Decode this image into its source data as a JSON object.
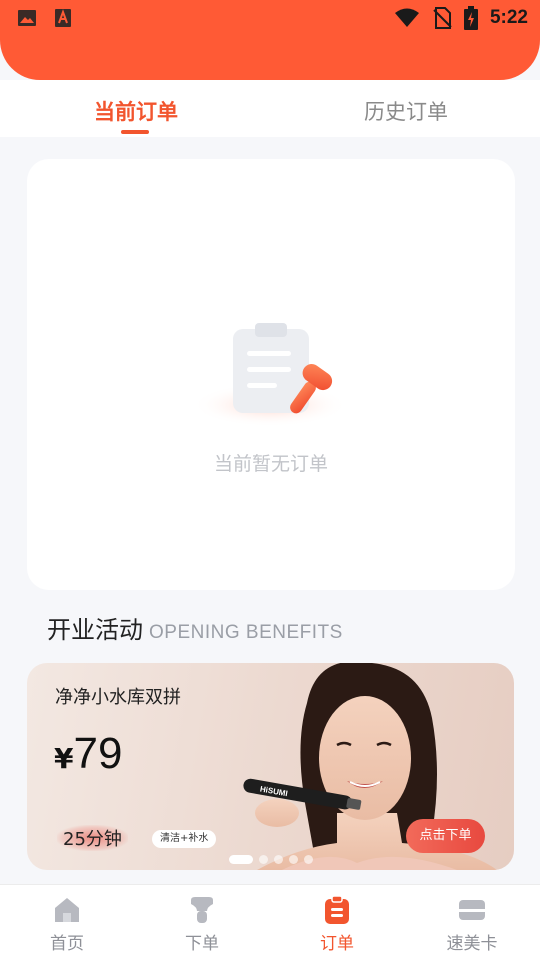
{
  "status_bar": {
    "time": "5:22",
    "left_icons": [
      "image-icon",
      "font-app-icon"
    ],
    "right_icons": [
      "wifi-icon",
      "no-sim-icon",
      "battery-charging-icon"
    ],
    "background_color": "#ff5a35"
  },
  "tabs": [
    {
      "label": "当前订单",
      "active": true
    },
    {
      "label": "历史订单",
      "active": false
    }
  ],
  "empty_state": {
    "illustration": "clipboard-icon",
    "text": "当前暂无订单"
  },
  "section": {
    "title_zh": "开业活动",
    "title_en": "OPENING BENEFITS"
  },
  "banner": {
    "title": "净净小水库双拼",
    "price_currency": "¥",
    "price_value": "79",
    "duration": "25分钟",
    "tag": "清洁+补水",
    "button_label": "点击下单",
    "device_brand": "HiSUMI",
    "carousel": {
      "count": 5,
      "active_index": 0
    }
  },
  "bottom_nav": [
    {
      "label": "首页",
      "icon": "home-icon",
      "active": false
    },
    {
      "label": "下单",
      "icon": "order-device-icon",
      "active": false
    },
    {
      "label": "订单",
      "icon": "order-list-icon",
      "active": true
    },
    {
      "label": "速美卡",
      "icon": "card-icon",
      "active": false
    }
  ],
  "colors": {
    "accent": "#f2552e",
    "inactive": "#8e9097",
    "page_background": "#f6f7fa"
  }
}
